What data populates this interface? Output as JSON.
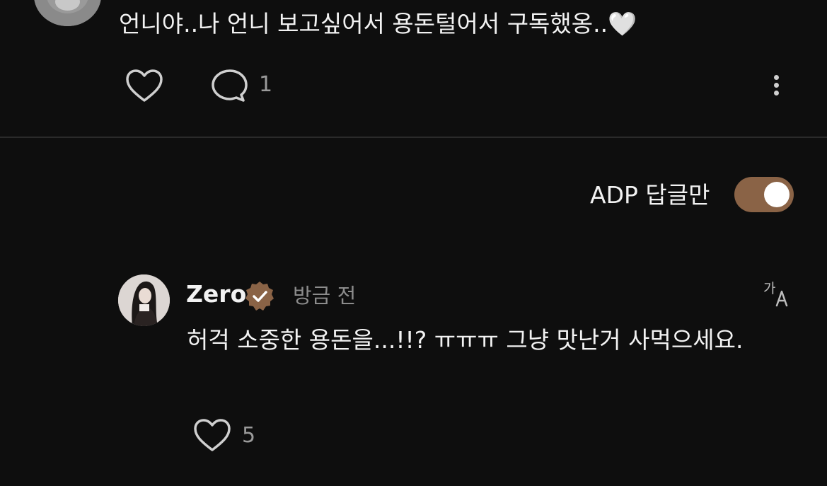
{
  "parent_comment": {
    "text": "언니야..나 언니 보고싶어서 용돈털어서 구독했옹..🤍",
    "reply_count": "1"
  },
  "filter": {
    "label": "ADP 답글만",
    "toggle_on": true,
    "toggle_color": "#8a6346"
  },
  "reply": {
    "username": "Zero",
    "verified_color": "#8a6346",
    "time": "방금 전",
    "text": "허걱 소중한 용돈을...!!? ㅠㅠㅠ 그냥 맛난거 사먹으세요.",
    "like_count": "5"
  }
}
